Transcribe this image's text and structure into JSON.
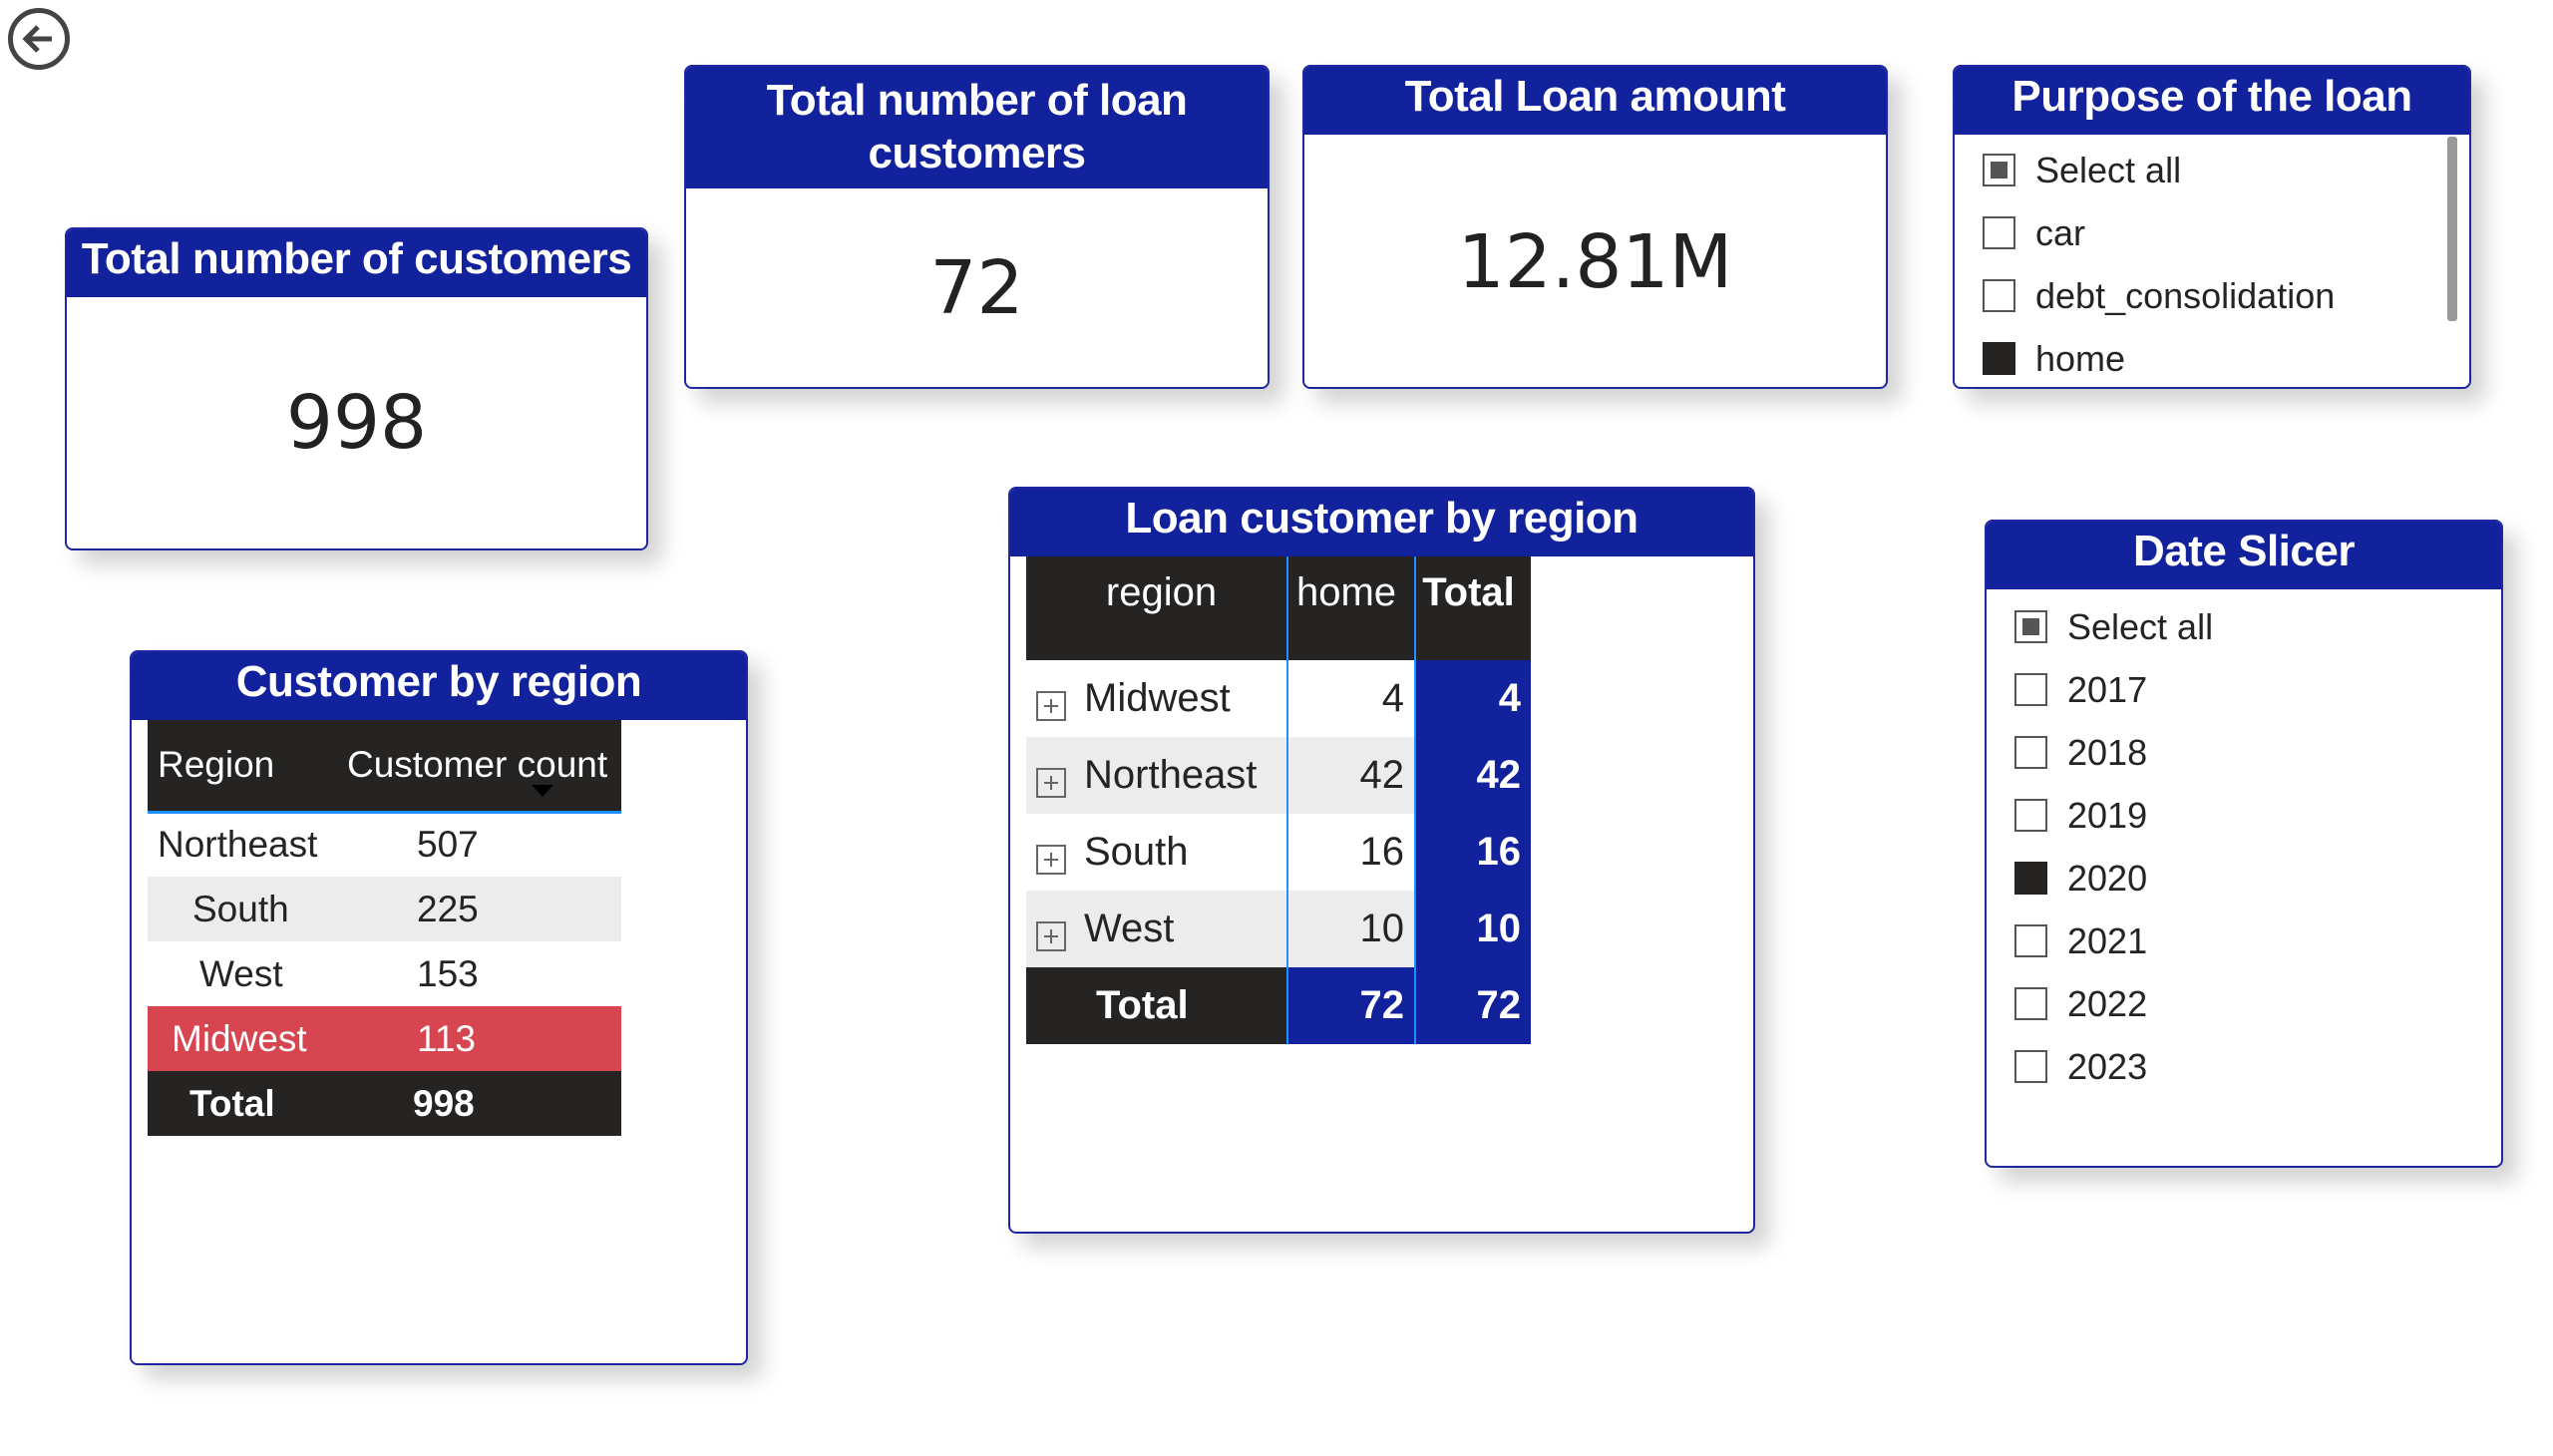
{
  "nav": {
    "back_icon": "arrow-left-circle-icon"
  },
  "kpi_customers": {
    "title": "Total number of customers",
    "value": "998"
  },
  "kpi_loan_customers": {
    "title": "Total number of loan customers",
    "value": "72"
  },
  "kpi_loan_amount": {
    "title": "Total Loan amount",
    "value": "12.81M"
  },
  "purpose_slicer": {
    "title": "Purpose of the loan",
    "items": [
      {
        "label": "Select all",
        "state": "partial"
      },
      {
        "label": "car",
        "state": "unchecked"
      },
      {
        "label": "debt_consolidation",
        "state": "unchecked"
      },
      {
        "label": "home",
        "state": "checked"
      }
    ]
  },
  "customer_by_region": {
    "title": "Customer by region",
    "headers": [
      "Region",
      "Customer count"
    ],
    "rows": [
      {
        "region": "Northeast",
        "count": "507"
      },
      {
        "region": "South",
        "count": "225"
      },
      {
        "region": "West",
        "count": "153"
      },
      {
        "region": "Midwest",
        "count": "113"
      }
    ],
    "total": {
      "label": "Total",
      "count": "998"
    },
    "highlight_color": "#d64550"
  },
  "loan_by_region": {
    "title": "Loan customer by region",
    "headers": [
      "region",
      "home",
      "Total"
    ],
    "rows": [
      {
        "region": "Midwest",
        "home": "4",
        "total": "4"
      },
      {
        "region": "Northeast",
        "home": "42",
        "total": "42"
      },
      {
        "region": "South",
        "home": "16",
        "total": "16"
      },
      {
        "region": "West",
        "home": "10",
        "total": "10"
      }
    ],
    "total": {
      "label": "Total",
      "home": "72",
      "total": "72"
    }
  },
  "date_slicer": {
    "title": "Date Slicer",
    "items": [
      {
        "label": "Select all",
        "state": "partial"
      },
      {
        "label": "2017",
        "state": "unchecked"
      },
      {
        "label": "2018",
        "state": "unchecked"
      },
      {
        "label": "2019",
        "state": "unchecked"
      },
      {
        "label": "2020",
        "state": "checked"
      },
      {
        "label": "2021",
        "state": "unchecked"
      },
      {
        "label": "2022",
        "state": "unchecked"
      },
      {
        "label": "2023",
        "state": "unchecked"
      }
    ]
  },
  "colors": {
    "header_blue": "#12219c",
    "dark": "#252423",
    "accent": "#1e90ff"
  }
}
